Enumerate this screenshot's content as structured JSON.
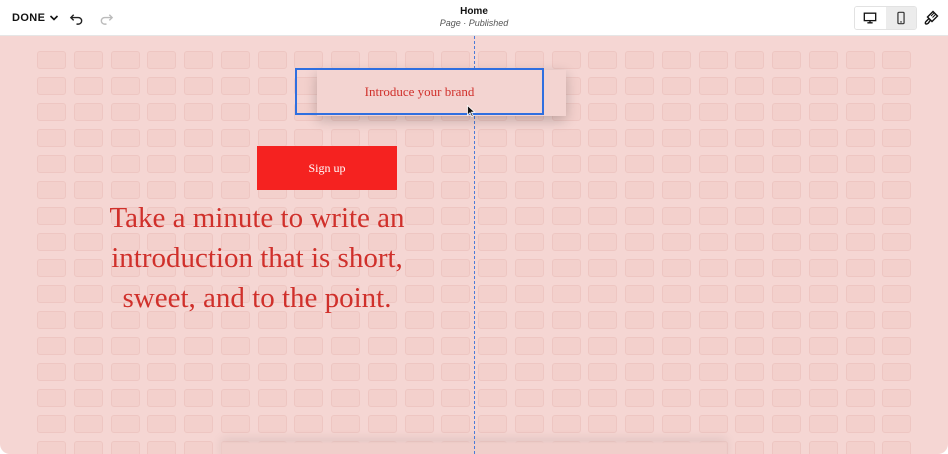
{
  "toolbar": {
    "done_label": "DONE",
    "undo_icon": "undo-icon",
    "redo_icon": "redo-icon",
    "page_title": "Home",
    "page_status": "Page · Published",
    "desktop_view_icon": "desktop-icon",
    "mobile_view_icon": "mobile-icon",
    "design_icon": "paintbrush-icon"
  },
  "canvas": {
    "background_color": "#f5d6d3",
    "accent_color": "#f52220",
    "text_color": "#d0302b",
    "selection_color": "#2f6fe0",
    "intro_block_text": "Introduce your brand",
    "signup_label": "Sign up",
    "headline_line1": "Take a minute to write an",
    "headline_line2": "introduction that is short,",
    "headline_line3": "sweet, and to the point."
  }
}
